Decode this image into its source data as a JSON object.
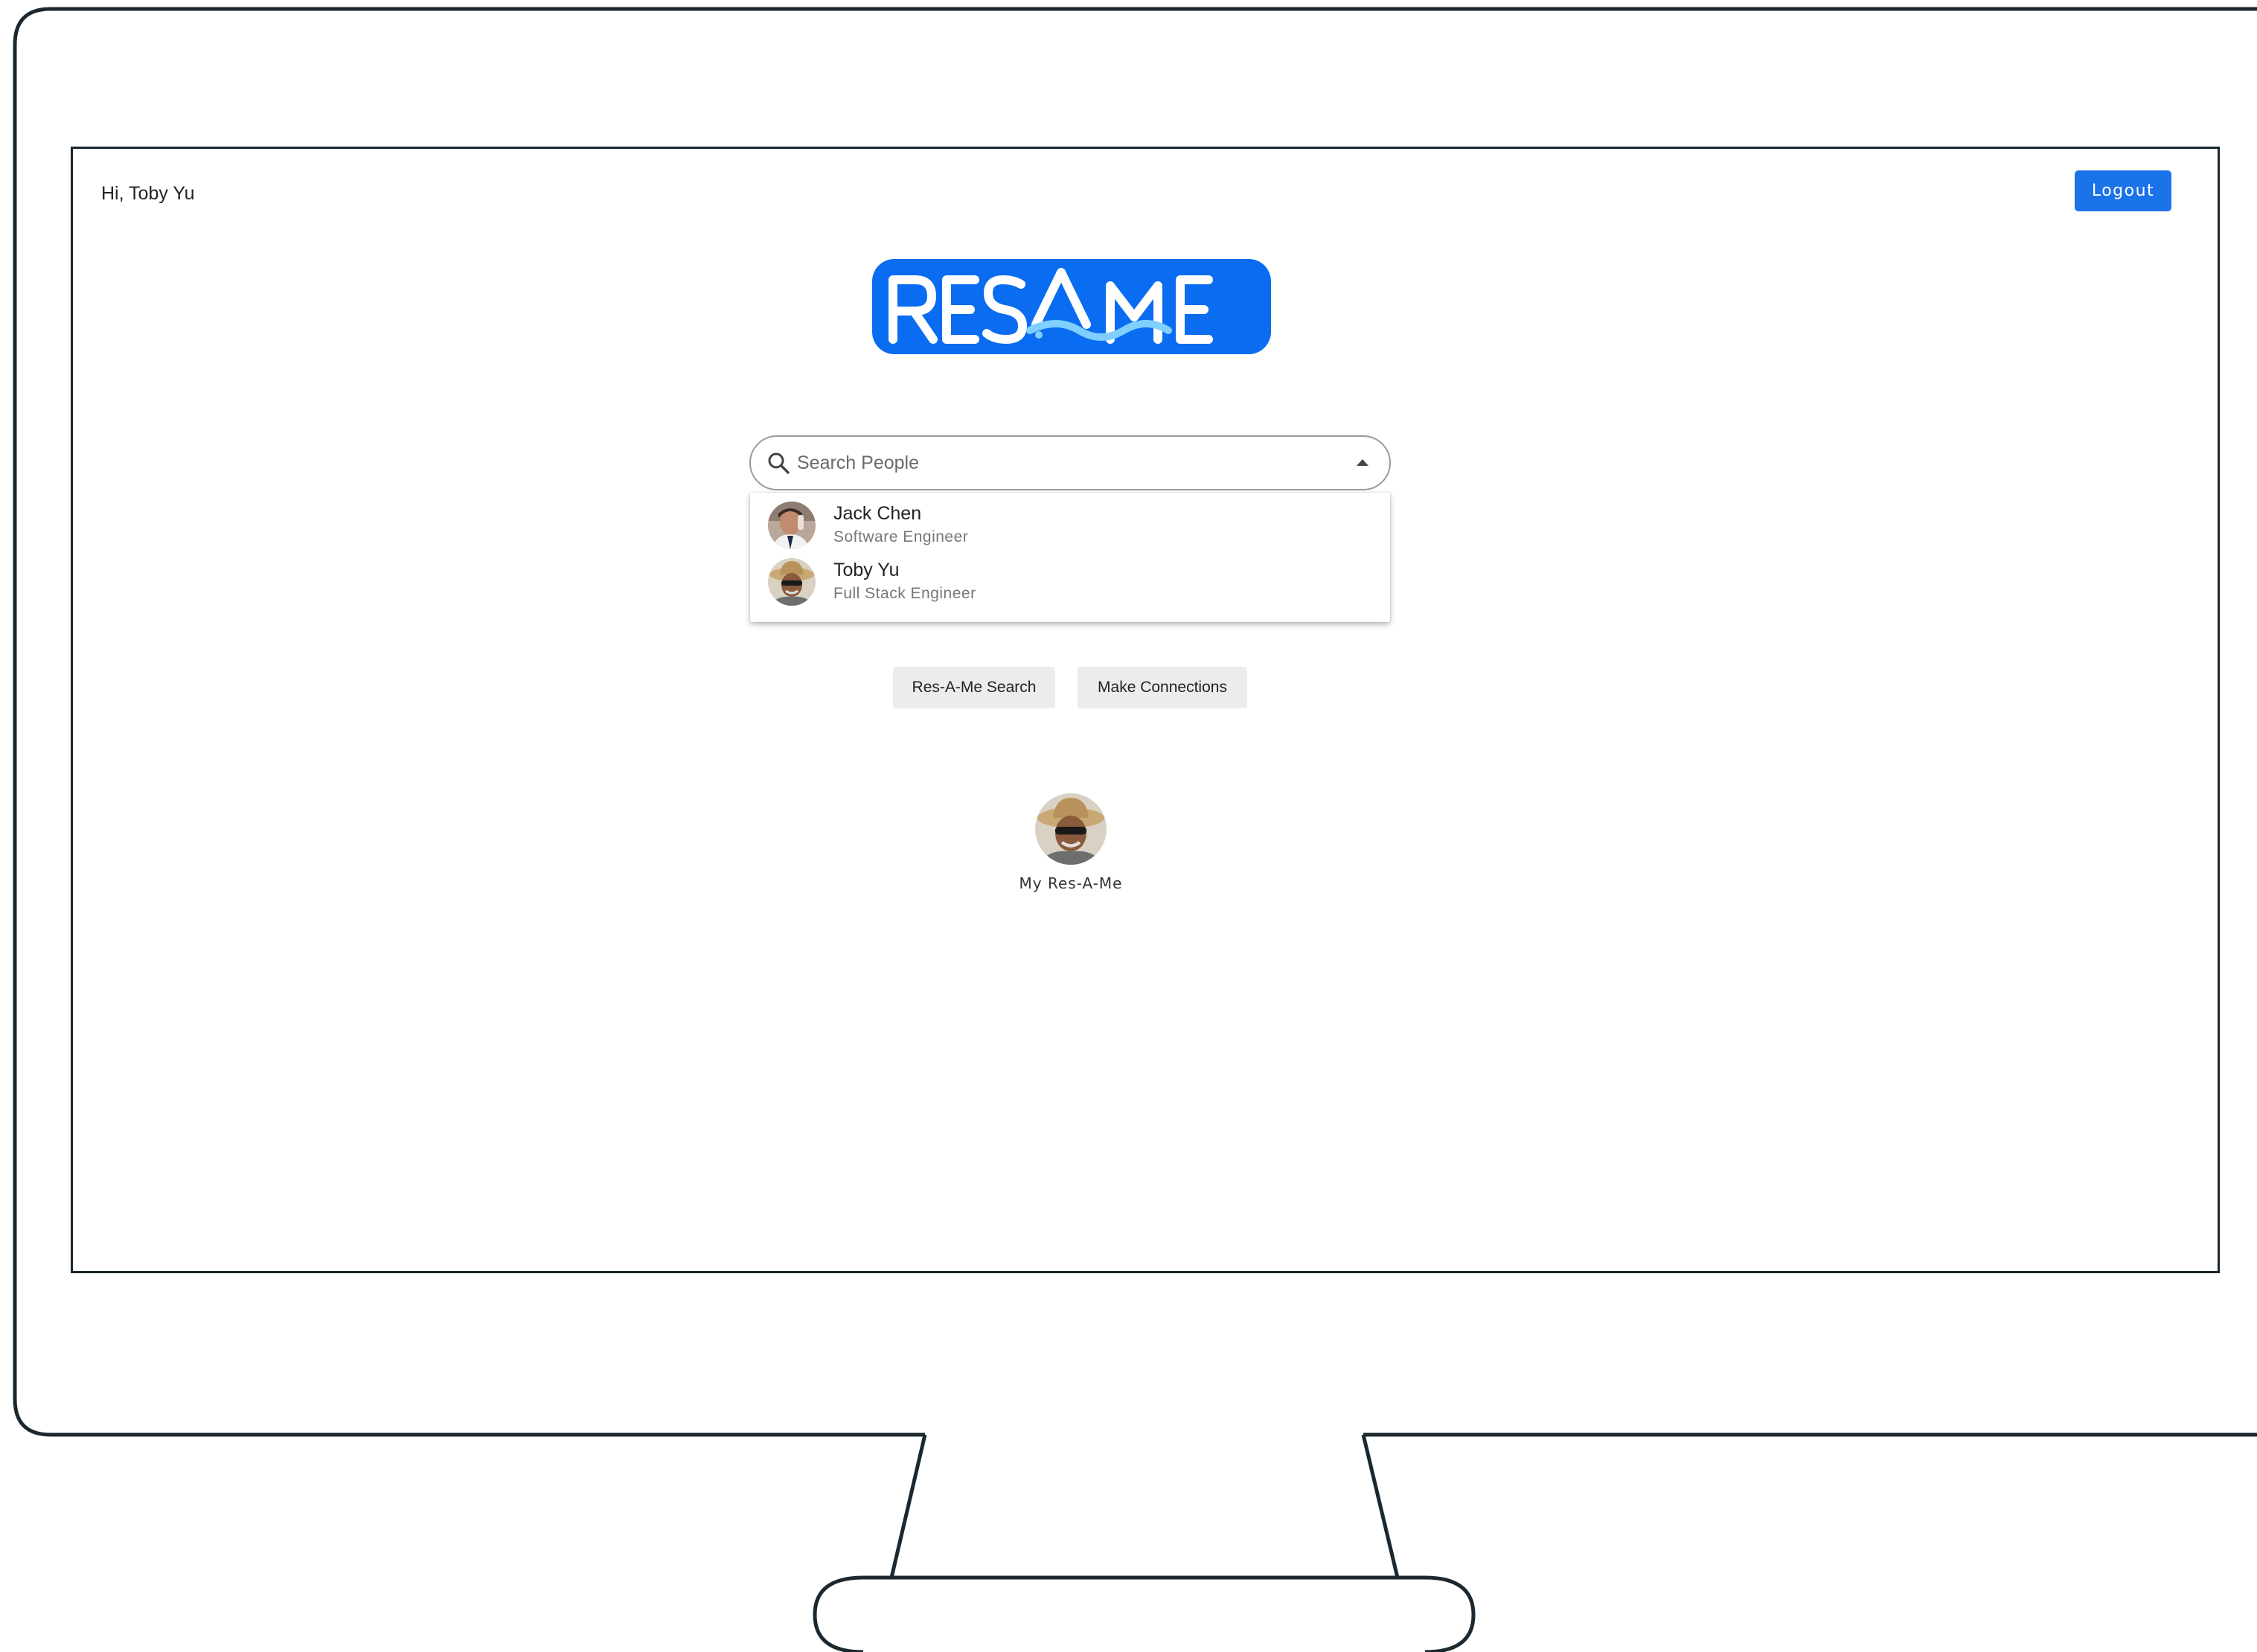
{
  "header": {
    "greeting": "Hi, Toby Yu",
    "logout_label": "Logout"
  },
  "logo": {
    "text": "RES-A-ME"
  },
  "search": {
    "placeholder": "Search People",
    "value": ""
  },
  "results": [
    {
      "name": "Jack Chen",
      "title": "Software Engineer"
    },
    {
      "name": "Toby Yu",
      "title": "Full Stack Engineer"
    }
  ],
  "actions": {
    "search_label": "Res-A-Me Search",
    "connect_label": "Make Connections"
  },
  "profile": {
    "label": "My Res-A-Me"
  },
  "colors": {
    "accent": "#1a73e8",
    "logo_blue": "#0a6cf0",
    "button_gray": "#ececec"
  },
  "icons": [
    "search-icon",
    "caret-up-icon",
    "avatar"
  ]
}
